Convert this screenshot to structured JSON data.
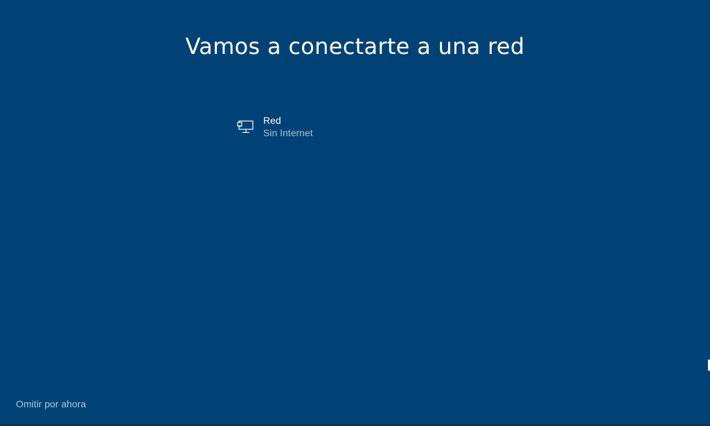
{
  "header": {
    "title": "Vamos a conectarte a una red"
  },
  "networks": [
    {
      "name": "Red",
      "status": "Sin Internet",
      "icon": "wired-network-icon"
    }
  ],
  "footer": {
    "skip_label": "Omitir por ahora"
  },
  "colors": {
    "background": "#004275",
    "text": "#ffffff",
    "secondary_text": "#a9c2d9",
    "link": "#a9c8e6"
  }
}
